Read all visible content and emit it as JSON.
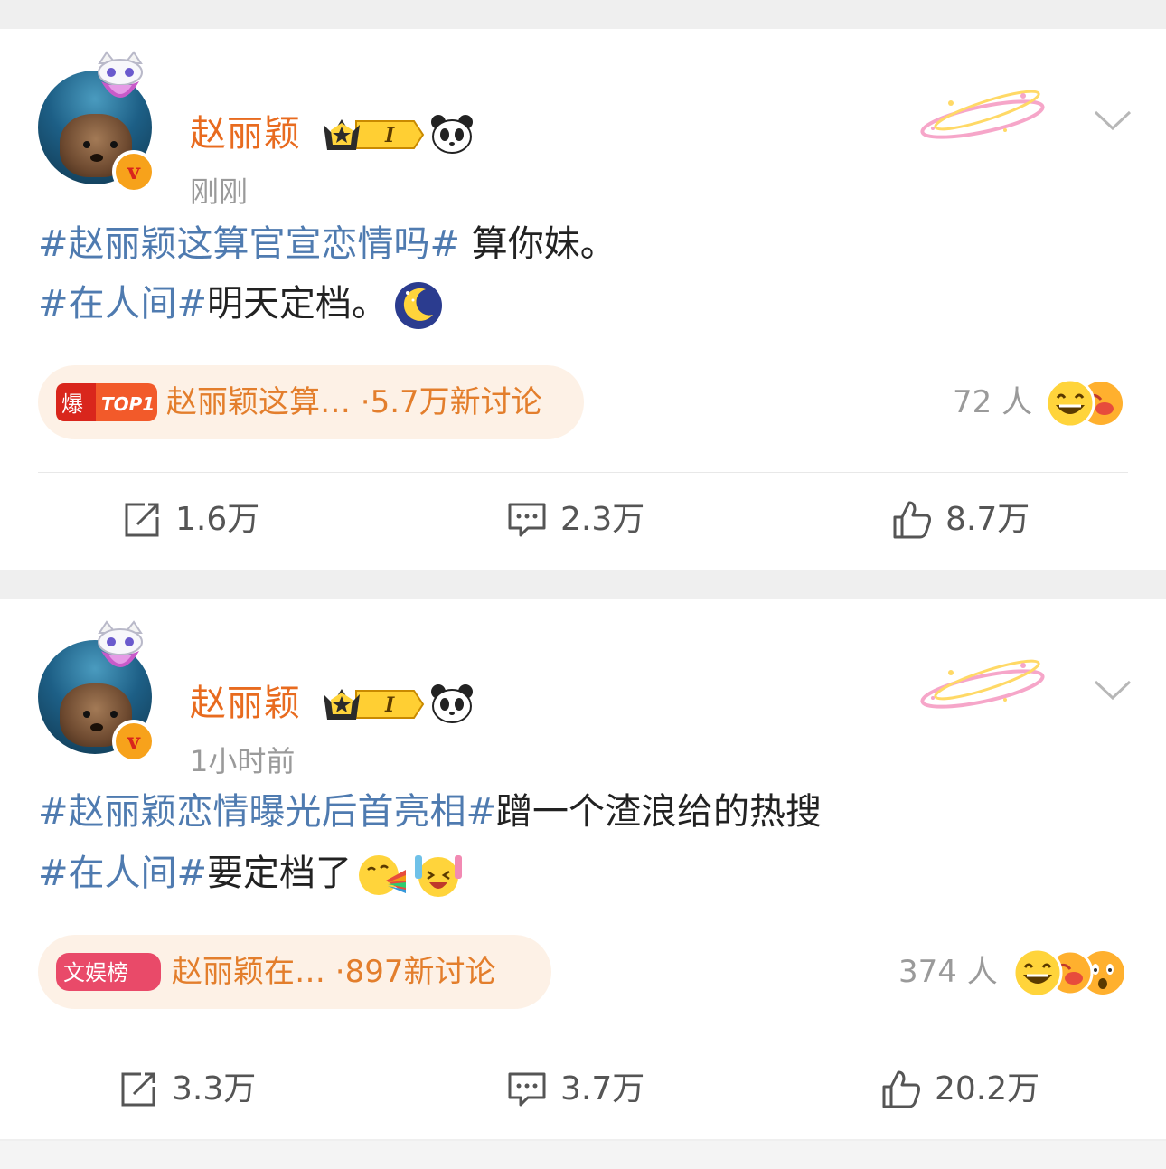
{
  "posts": [
    {
      "username": "赵丽颖",
      "level_badge": "I",
      "time": "刚刚",
      "line1_tag": "#赵丽颖这算官宣恋情吗#",
      "line1_text": " 算你妹。",
      "line2_tag": "#在人间#",
      "line2_text": "明天定档。",
      "hot_badge_char": "爆",
      "hot_badge_rank": "TOP1",
      "hot_label": "赵丽颖这算… ·5.7万新讨论",
      "reaction_count": "72 人",
      "repost": "1.6万",
      "comment": "2.3万",
      "like": "8.7万"
    },
    {
      "username": "赵丽颖",
      "level_badge": "I",
      "time": "1小时前",
      "line1_tag": "#赵丽颖恋情曝光后首亮相#",
      "line1_text": "蹭一个渣浪给的热搜",
      "line2_tag": "#在人间#",
      "line2_text": "要定档了",
      "hot_badge_char": "文娱榜",
      "hot_label": "赵丽颖在… ·897新讨论",
      "reaction_count": "374 人",
      "repost": "3.3万",
      "comment": "3.7万",
      "like": "20.2万"
    }
  ],
  "icons": {
    "repost": "repost-icon",
    "comment": "comment-icon",
    "like": "thumbs-up-icon",
    "menu": "chevron-down-icon"
  },
  "colors": {
    "username": "#e86b1f",
    "hashtag": "#4f7bb0",
    "hot_label": "#e37e2c",
    "meta": "#9a9a9a"
  }
}
